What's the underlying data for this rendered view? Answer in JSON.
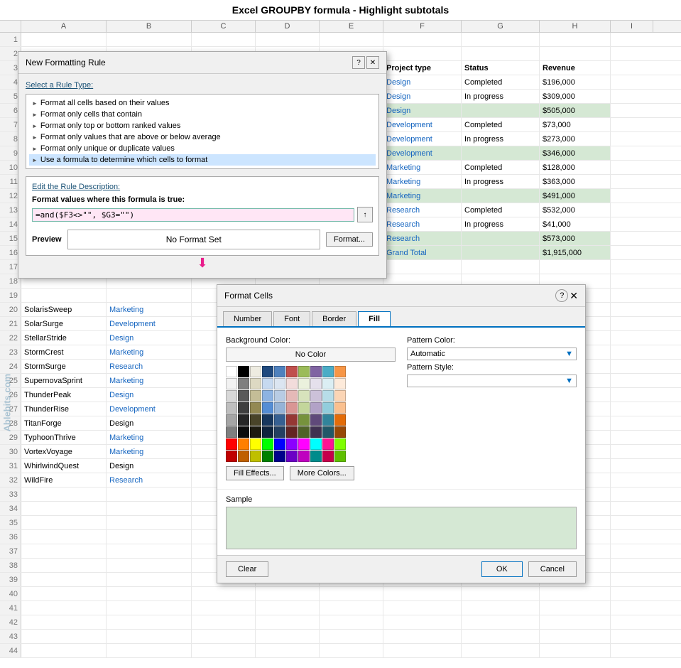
{
  "page": {
    "title": "Excel GROUPBY formula - Highlight subtotals"
  },
  "columns": {
    "row_num": "#",
    "a": "A",
    "b": "B",
    "c": "C",
    "d": "D",
    "e": "E",
    "f": "F",
    "g": "G",
    "h": "H",
    "i": "I"
  },
  "spreadsheet_rows": [
    {
      "num": "1",
      "a": "",
      "b": "",
      "c": "",
      "d": "",
      "e": "",
      "f": "",
      "g": "",
      "h": ""
    },
    {
      "num": "2",
      "a": "",
      "b": "",
      "c": "",
      "d": "",
      "e": "",
      "f": "",
      "g": "",
      "h": ""
    },
    {
      "num": "3",
      "a": "",
      "b": "",
      "c": "",
      "d": "",
      "e": "",
      "f": "Project type",
      "g": "Status",
      "h": "Revenue",
      "header": true
    },
    {
      "num": "4",
      "a": "",
      "b": "",
      "c": "",
      "d": "",
      "e": "",
      "f": "Design",
      "g": "Completed",
      "h": "$196,000",
      "f_blue": true
    },
    {
      "num": "5",
      "a": "",
      "b": "",
      "c": "",
      "d": "",
      "e": "",
      "f": "Design",
      "g": "In progress",
      "h": "$309,000",
      "f_blue": true
    },
    {
      "num": "6",
      "a": "",
      "b": "",
      "c": "",
      "d": "",
      "e": "",
      "f": "Design",
      "g": "",
      "h": "$505,000",
      "f_blue": true,
      "green": true
    },
    {
      "num": "7",
      "a": "",
      "b": "",
      "c": "",
      "d": "",
      "e": "",
      "f": "Development",
      "g": "Completed",
      "h": "$73,000",
      "f_blue": true
    },
    {
      "num": "8",
      "a": "",
      "b": "",
      "c": "",
      "d": "",
      "e": "",
      "f": "Development",
      "g": "In progress",
      "h": "$273,000",
      "f_blue": true
    },
    {
      "num": "9",
      "a": "",
      "b": "",
      "c": "",
      "d": "",
      "e": "",
      "f": "Development",
      "g": "",
      "h": "$346,000",
      "f_blue": true,
      "green": true
    },
    {
      "num": "10",
      "a": "",
      "b": "",
      "c": "",
      "d": "",
      "e": "",
      "f": "Marketing",
      "g": "Completed",
      "h": "$128,000",
      "f_blue": true
    },
    {
      "num": "11",
      "a": "",
      "b": "",
      "c": "",
      "d": "",
      "e": "",
      "f": "Marketing",
      "g": "In progress",
      "h": "$363,000",
      "f_blue": true
    },
    {
      "num": "12",
      "a": "",
      "b": "",
      "c": "",
      "d": "",
      "e": "",
      "f": "Marketing",
      "g": "",
      "h": "$491,000",
      "f_blue": true,
      "green": true
    },
    {
      "num": "13",
      "a": "",
      "b": "",
      "c": "",
      "d": "",
      "e": "",
      "f": "Research",
      "g": "Completed",
      "h": "$532,000",
      "f_blue": true
    },
    {
      "num": "14",
      "a": "",
      "b": "",
      "c": "",
      "d": "",
      "e": "",
      "f": "Research",
      "g": "In progress",
      "h": "$41,000",
      "f_blue": true
    },
    {
      "num": "15",
      "a": "",
      "b": "",
      "c": "",
      "d": "",
      "e": "",
      "f": "Research",
      "g": "",
      "h": "$573,000",
      "f_blue": true,
      "green": true
    },
    {
      "num": "16",
      "a": "",
      "b": "",
      "c": "",
      "d": "",
      "e": "",
      "f": "Grand Total",
      "g": "",
      "h": "$1,915,000",
      "f_blue": true,
      "green": true
    },
    {
      "num": "17",
      "a": "",
      "b": "",
      "c": "",
      "d": "",
      "e": "",
      "f": "",
      "g": "",
      "h": ""
    },
    {
      "num": "18",
      "a": "",
      "b": "",
      "c": "",
      "d": "",
      "e": "",
      "f": "",
      "g": "",
      "h": ""
    },
    {
      "num": "19",
      "a": "",
      "b": "",
      "c": "",
      "d": "",
      "e": "",
      "f": "",
      "g": "",
      "h": ""
    },
    {
      "num": "20",
      "a": "SolarisSweep",
      "b": "Marketing",
      "c": "",
      "d": "",
      "e": "",
      "f": "",
      "g": "",
      "h": "",
      "b_blue": true
    },
    {
      "num": "21",
      "a": "SolarSurge",
      "b": "Development",
      "c": "",
      "d": "",
      "e": "",
      "f": "",
      "g": "",
      "h": "",
      "b_blue": true
    },
    {
      "num": "22",
      "a": "StellarStride",
      "b": "Design",
      "c": "",
      "d": "",
      "e": "",
      "f": "",
      "g": "",
      "h": "",
      "b_blue": true
    },
    {
      "num": "23",
      "a": "StormCrest",
      "b": "Marketing",
      "c": "",
      "d": "",
      "e": "",
      "f": "",
      "g": "",
      "h": "",
      "b_blue": true
    },
    {
      "num": "24",
      "a": "StormSurge",
      "b": "Research",
      "c": "",
      "d": "",
      "e": "",
      "f": "",
      "g": "",
      "h": "",
      "b_blue": true
    },
    {
      "num": "25",
      "a": "SupernovaSprint",
      "b": "Marketing",
      "c": "",
      "d": "",
      "e": "",
      "f": "",
      "g": "",
      "h": "",
      "b_blue": true
    },
    {
      "num": "26",
      "a": "ThunderPeak",
      "b": "Design",
      "c": "",
      "d": "",
      "e": "",
      "f": "",
      "g": "",
      "h": "",
      "b_blue": true
    },
    {
      "num": "27",
      "a": "ThunderRise",
      "b": "Development",
      "c": "",
      "d": "",
      "e": "",
      "f": "",
      "g": "",
      "h": "",
      "b_blue": true
    },
    {
      "num": "28",
      "a": "TitanForge",
      "b": "Design",
      "c": "",
      "d": "",
      "e": "",
      "f": "",
      "g": "",
      "h": ""
    },
    {
      "num": "29",
      "a": "TyphoonThrive",
      "b": "Marketing",
      "c": "",
      "d": "",
      "e": "",
      "f": "",
      "g": "",
      "h": "",
      "b_blue": true
    },
    {
      "num": "30",
      "a": "VortexVoyage",
      "b": "Marketing",
      "c": "",
      "d": "",
      "e": "",
      "f": "",
      "g": "",
      "h": "",
      "b_blue": true
    },
    {
      "num": "31",
      "a": "WhirlwindQuest",
      "b": "Design",
      "c": "",
      "d": "",
      "e": "",
      "f": "",
      "g": "",
      "h": ""
    },
    {
      "num": "32",
      "a": "WildFire",
      "b": "Research",
      "c": "",
      "d": "",
      "e": "",
      "f": "",
      "g": "",
      "h": "",
      "b_blue": true
    },
    {
      "num": "33",
      "a": "",
      "b": "",
      "c": "",
      "d": "",
      "e": "",
      "f": "",
      "g": "",
      "h": ""
    },
    {
      "num": "34",
      "a": "",
      "b": "",
      "c": "",
      "d": "",
      "e": "",
      "f": "",
      "g": "",
      "h": ""
    },
    {
      "num": "35",
      "a": "",
      "b": "",
      "c": "",
      "d": "",
      "e": "",
      "f": "",
      "g": "",
      "h": ""
    },
    {
      "num": "36",
      "a": "",
      "b": "",
      "c": "",
      "d": "",
      "e": "",
      "f": "",
      "g": "",
      "h": ""
    },
    {
      "num": "37",
      "a": "",
      "b": "",
      "c": "",
      "d": "",
      "e": "",
      "f": "",
      "g": "",
      "h": ""
    },
    {
      "num": "38",
      "a": "",
      "b": "",
      "c": "",
      "d": "",
      "e": "",
      "f": "",
      "g": "",
      "h": ""
    },
    {
      "num": "39",
      "a": "",
      "b": "",
      "c": "",
      "d": "",
      "e": "",
      "f": "",
      "g": "",
      "h": ""
    },
    {
      "num": "40",
      "a": "",
      "b": "",
      "c": "",
      "d": "",
      "e": "",
      "f": "",
      "g": "",
      "h": ""
    },
    {
      "num": "41",
      "a": "",
      "b": "",
      "c": "",
      "d": "",
      "e": "",
      "f": "",
      "g": "",
      "h": ""
    },
    {
      "num": "42",
      "a": "",
      "b": "",
      "c": "",
      "d": "",
      "e": "",
      "f": "",
      "g": "",
      "h": ""
    },
    {
      "num": "43",
      "a": "",
      "b": "",
      "c": "",
      "d": "",
      "e": "",
      "f": "",
      "g": "",
      "h": ""
    },
    {
      "num": "44",
      "a": "",
      "b": "",
      "c": "",
      "d": "",
      "e": "",
      "f": "",
      "g": "",
      "h": ""
    }
  ],
  "nfr_dialog": {
    "title": "New Formatting Rule",
    "rule_types_label": "Select a Rule Type:",
    "rule_types": [
      "Format all cells based on their values",
      "Format only cells that contain",
      "Format only top or bottom ranked values",
      "Format only values that are above or below average",
      "Format only unique or duplicate values",
      "Use a formula to determine which cells to format"
    ],
    "selected_rule_index": 5,
    "edit_label": "Edit the Rule Description:",
    "formula_label": "Format values where this formula is true:",
    "formula_value": "=and($F3<>\"\", $G3=\"\")",
    "preview_label": "Preview",
    "no_format_text": "No Format Set",
    "format_btn": "Format..."
  },
  "fc_dialog": {
    "title": "Format Cells",
    "tabs": [
      "Number",
      "Font",
      "Border",
      "Fill"
    ],
    "active_tab": "Fill",
    "bg_color_label": "Background Color:",
    "no_color_btn": "No Color",
    "pattern_color_label": "Pattern Color:",
    "pattern_color_value": "Automatic",
    "pattern_style_label": "Pattern Style:",
    "fill_effects_btn": "Fill Effects...",
    "more_colors_btn": "More Colors...",
    "sample_label": "Sample",
    "clear_btn": "Clear",
    "ok_btn": "OK",
    "cancel_btn": "Cancel"
  },
  "color_swatches": {
    "row1": [
      "#000000",
      "#1f1f1f",
      "#404040",
      "#606060",
      "#808080",
      "#a0a0a0",
      "#c0c0c0",
      "#d8d8d8",
      "#f0f0f0",
      "#ffffff",
      "#4d0000",
      "#800000",
      "#cc0000",
      "#ff0000",
      "#ff6600",
      "#ffa500",
      "#ffcc00",
      "#ffff00",
      "#ccff00",
      "#66ff00"
    ],
    "row2": [
      "#e6f2ff",
      "#cce5ff",
      "#b3d9ff",
      "#99ccff",
      "#80c0ff",
      "#66b3ff",
      "#4da6ff",
      "#3399ff",
      "#1a8cff",
      "#0080ff",
      "#001a4d",
      "#003380",
      "#0050cc",
      "#0066ff",
      "#1a75ff",
      "#3385ff",
      "#4d94ff",
      "#66a3ff",
      "#80b3ff",
      "#99c2ff"
    ],
    "row3": [
      "#e6fff2",
      "#ccffee",
      "#b3ffdd",
      "#99ffcc",
      "#80ffbb",
      "#66ffaa",
      "#4dff99",
      "#33ff88",
      "#1aff77",
      "#00ff66",
      "#001a0d",
      "#00331a",
      "#005028",
      "#006633",
      "#1a7a40",
      "#338c4d",
      "#4d9e59",
      "#66b066",
      "#80c273",
      "#99d480"
    ],
    "row4": [
      "#fff5e6",
      "#ffeacc",
      "#ffdeb3",
      "#ffd299",
      "#ffc680",
      "#ffba66",
      "#ffae4d",
      "#ffa333",
      "#ff971a",
      "#ff8b00",
      "#4d2600",
      "#804000",
      "#cc6600",
      "#ff8c00",
      "#ffa31a",
      "#ffb833",
      "#ffcc4d",
      "#ffe066",
      "#fff080",
      "#fff599"
    ],
    "row5": [
      "#ffe6f5",
      "#ffcceb",
      "#ffb3e0",
      "#ff99d6",
      "#ff80cc",
      "#ff66c2",
      "#ff4db8",
      "#ff33ae",
      "#ff1aa4",
      "#ff009a",
      "#4d0029",
      "#800044",
      "#cc006e",
      "#ff0088",
      "#ff1a95",
      "#ff33a2",
      "#ff4daf",
      "#ff66bc",
      "#ff80c9",
      "#ff99d6"
    ],
    "row6": [
      "#ff0000",
      "#ff3300",
      "#ff6600",
      "#ff9900",
      "#ffcc00",
      "#ffff00",
      "#99ff00",
      "#33ff00",
      "#00ff66",
      "#00ffcc",
      "#0066ff",
      "#0033ff",
      "#3300ff",
      "#6600ff",
      "#9900ff",
      "#cc00ff",
      "#ff00ff",
      "#ff00cc",
      "#ff0099",
      "#660033"
    ]
  },
  "watermark": "Ablebits.com"
}
